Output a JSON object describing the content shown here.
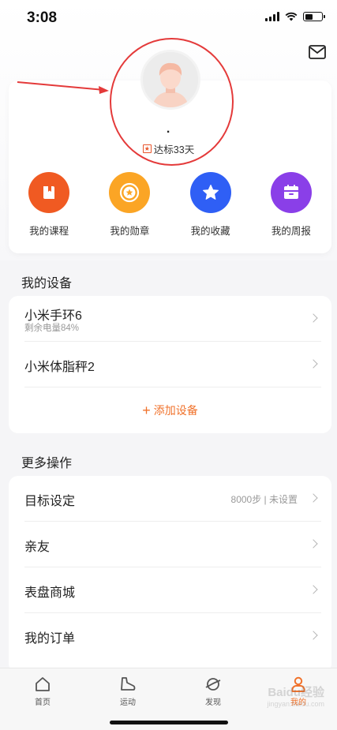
{
  "status_bar": {
    "time": "3:08"
  },
  "profile": {
    "username": "·",
    "streak_label": "达标33天"
  },
  "quick_actions": [
    {
      "label": "我的课程",
      "icon": "book-icon",
      "color": "#f05a22"
    },
    {
      "label": "我的勋章",
      "icon": "medal-icon",
      "color": "#fba525"
    },
    {
      "label": "我的收藏",
      "icon": "star-icon",
      "color": "#2f5ff5"
    },
    {
      "label": "我的周报",
      "icon": "report-icon",
      "color": "#8a3fe8"
    }
  ],
  "devices": {
    "section_title": "我的设备",
    "items": [
      {
        "name": "小米手环6",
        "sub": "剩余电量84%"
      },
      {
        "name": "小米体脂秤2",
        "sub": ""
      }
    ],
    "add_label": "添加设备"
  },
  "more": {
    "section_title": "更多操作",
    "items": [
      {
        "name": "目标设定",
        "value": "8000步 | 未设置"
      },
      {
        "name": "亲友",
        "value": ""
      },
      {
        "name": "表盘商城",
        "value": ""
      },
      {
        "name": "我的订单",
        "value": ""
      }
    ]
  },
  "tabs": [
    {
      "label": "首页",
      "icon": "home-icon"
    },
    {
      "label": "运动",
      "icon": "shoe-icon"
    },
    {
      "label": "发现",
      "icon": "planet-icon"
    },
    {
      "label": "我的",
      "icon": "person-icon",
      "active": true
    }
  ],
  "watermark": {
    "line1": "Baidu经验",
    "line2": "jingyan.baidu.com"
  },
  "colors": {
    "accent": "#f0722b",
    "annotation": "#e43a3a"
  }
}
